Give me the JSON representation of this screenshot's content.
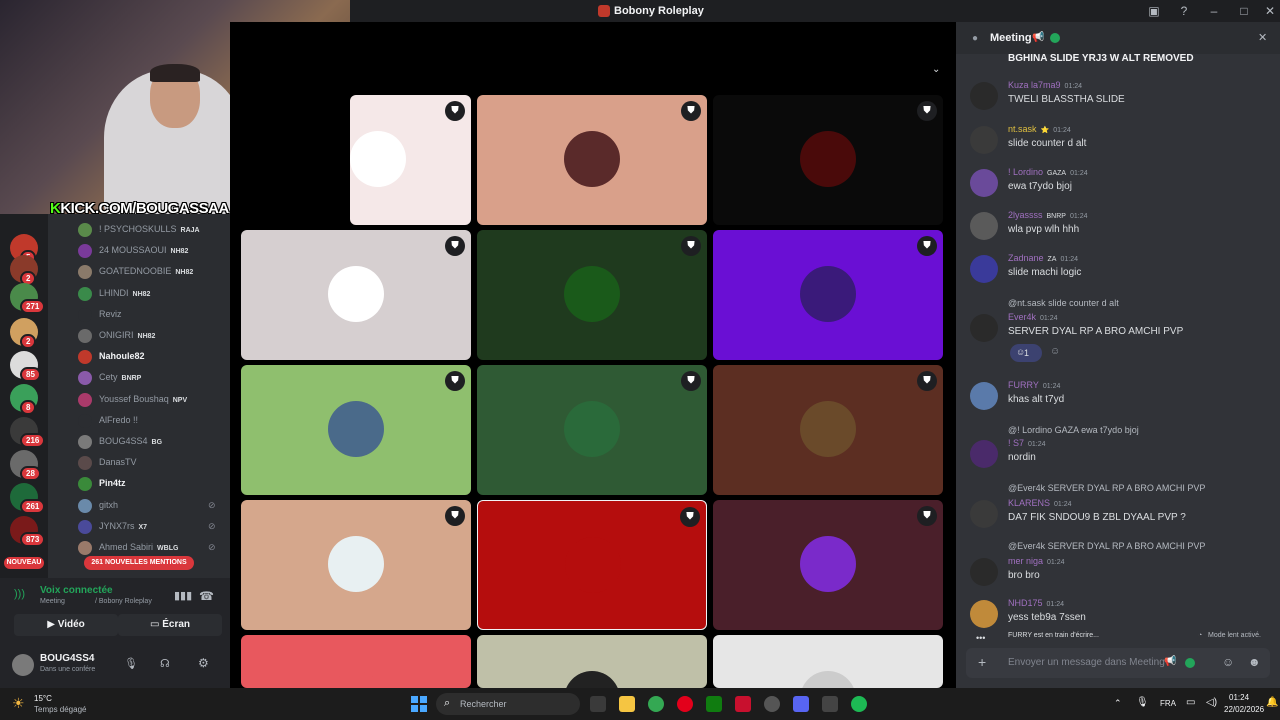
{
  "window": {
    "title": "Bobony Roleplay"
  },
  "overlay": {
    "kick_brand": "KICK.COM/BOUGASSAA"
  },
  "rail": {
    "badges": [
      "5",
      "2",
      "271",
      "2",
      "85",
      "8",
      "216",
      "28",
      "261",
      "873"
    ],
    "new_label": "NOUVEAU"
  },
  "members": [
    {
      "name": "! PSYCHOSKULLS",
      "tag": "RAJA",
      "color": "#5a8a4a"
    },
    {
      "name": "24 MOUSSAOUI",
      "tag": "NH82",
      "color": "#7a3a9a"
    },
    {
      "name": "GOATEDNOOBIE",
      "tag": "NH82",
      "color": "#8a7a6a"
    },
    {
      "name": "LHINDI",
      "tag": "NH82",
      "color": "#3a8a4a"
    },
    {
      "name": "Reviz",
      "tag": "",
      "color": "#2b2d31"
    },
    {
      "name": "ONIGIRI",
      "tag": "NH82",
      "color": "#6a6a6a"
    },
    {
      "name": "Nahoule82",
      "tag": "",
      "color": "#c0392b"
    },
    {
      "name": "Cety",
      "tag": "BNRP",
      "color": "#8a5aaa"
    },
    {
      "name": "Youssef Boushaq",
      "tag": "NPV",
      "color": "#aa3a6a"
    },
    {
      "name": "AlFredo !!",
      "tag": "",
      "color": "#2b2d31"
    },
    {
      "name": "BOUG4SS4",
      "tag": "BG",
      "color": "#7a7a7a"
    },
    {
      "name": "DanasTV",
      "tag": "",
      "color": "#5a4a4a"
    },
    {
      "name": "Pin4tz",
      "tag": "",
      "color": "#3a8a3a"
    },
    {
      "name": "gitxh",
      "tag": "",
      "color": "#6a8aaa"
    },
    {
      "name": "JYNX7rs",
      "tag": "X7",
      "color": "#4a4a9a"
    },
    {
      "name": "Ahmed Sabiri",
      "tag": "WBLG",
      "color": "#9a7a6a"
    }
  ],
  "mentions_pill": "261 NOUVELLES MENTIONS",
  "voice": {
    "status": "Voix connectée",
    "channel": "Meeting",
    "server": "/ Bobony Roleplay",
    "video_label": "Vidéo",
    "screen_label": "Écran"
  },
  "user": {
    "name": "BOUG4SS4",
    "status": "Dans une confére"
  },
  "tiles": [
    {
      "bg": "#f5e8e8",
      "av": "#ffffff"
    },
    {
      "bg": "#d9a08a",
      "av": "#5a2a2a"
    },
    {
      "bg": "#0a0a0a",
      "av": "#4a0a0a"
    },
    {
      "bg": "#d6cfd0",
      "av": "#ffffff"
    },
    {
      "bg": "#1f3a1e",
      "av": "#1a5a1a"
    },
    {
      "bg": "#6a0fd4",
      "av": "#3a1a7a"
    },
    {
      "bg": "#8fbf6e",
      "av": "#4a6a8a"
    },
    {
      "bg": "#2f5a34",
      "av": "#2a6a3a"
    },
    {
      "bg": "#5c2e22",
      "av": "#6a4a2a"
    },
    {
      "bg": "#d5a78c",
      "av": "#e8f0f2"
    },
    {
      "bg": "#b50d0d",
      "av": "#b50d0d"
    },
    {
      "bg": "#4a1f2a",
      "av": "#7a2aca"
    },
    {
      "bg": "#e8585e",
      "av": "#e8585e"
    },
    {
      "bg": "#bfc0a8",
      "av": "#222222"
    },
    {
      "bg": "#e6e6e6",
      "av": "#cccccc"
    }
  ],
  "chat": {
    "channel": "Meeting",
    "top_line": "BGHINA SLIDE YRJ3  W ALT  REMOVED",
    "messages": [
      {
        "user": "Kuza la7ma9",
        "badge": "",
        "time": "01:24",
        "text": "TWELI BLASSTHA SLIDE",
        "color": "#a070c0",
        "av": "#2a2a2a"
      },
      {
        "user": "nt.sask",
        "badge": "⭐",
        "time": "01:24",
        "text": "slide counter d alt",
        "color": "#e0c040",
        "av": "#3a3a3a"
      },
      {
        "user": "! Lordino",
        "badge": "GAZA",
        "time": "01:24",
        "text": "ewa t7ydo bjoj",
        "color": "#a070c0",
        "av": "#6a4a9a"
      },
      {
        "user": "2lyassss",
        "badge": "BNRP",
        "time": "01:24",
        "text": "wla pvp wlh hhh",
        "color": "#a070c0",
        "av": "#5a5a5a"
      },
      {
        "user": "Zadnane",
        "badge": "ZA",
        "time": "01:24",
        "text": "slide machi logic",
        "color": "#a070c0",
        "av": "#3a3a9a"
      },
      {
        "user": "Ever4k",
        "badge": "",
        "time": "01:24",
        "text": "SERVER DYAL RP A BRO AMCHI PVP",
        "color": "#a070c0",
        "av": "#2a2a2a"
      },
      {
        "user": "FURRY",
        "badge": "",
        "time": "01:24",
        "text": "khas alt t7yd",
        "color": "#a070c0",
        "av": "#5a7aaa"
      },
      {
        "user": "! S7",
        "badge": "",
        "time": "01:24",
        "text": "nordin",
        "color": "#a070c0",
        "av": "#4a2a6a"
      },
      {
        "user": "KLARENS",
        "badge": "",
        "time": "01:24",
        "text": "DA7 FIK SNDOU9 B ZBL DYAAL PVP ?",
        "color": "#a070c0",
        "av": "#3a3a3a"
      },
      {
        "user": "mer niga",
        "badge": "",
        "time": "01:24",
        "text": "bro bro",
        "color": "#a070c0",
        "av": "#2a2a2a"
      },
      {
        "user": "NHD175",
        "badge": "",
        "time": "01:24",
        "text": "yess teb9a 7ssen",
        "color": "#a070c0",
        "av": "#c08a3a"
      }
    ],
    "replies": [
      "@nt.sask slide counter d alt",
      "@! Lordino  GAZA  ewa t7ydo bjoj",
      "@Ever4k SERVER DYAL RP A BRO AMCHI PVP",
      "@Ever4k SERVER DYAL RP A BRO AMCHI PVP"
    ],
    "reaction_count": "1",
    "typing": "FURRY est en train d'écrire...",
    "slow_mode": "Mode lent activé.",
    "input_placeholder": "Envoyer un message dans Meeting"
  },
  "taskbar": {
    "weather_temp": "15°C",
    "weather_desc": "Temps dégagé",
    "search_placeholder": "Rechercher",
    "lang": "FRA",
    "time": "01:24",
    "date": "22/02/2026"
  }
}
